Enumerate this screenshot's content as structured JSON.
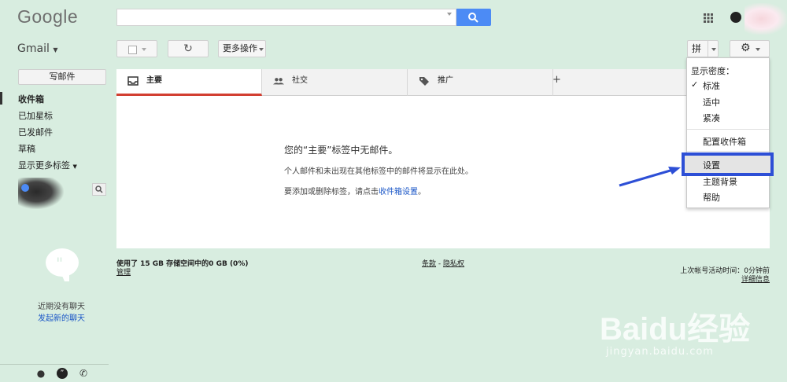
{
  "header": {
    "logo": "Google",
    "search": {
      "value": "",
      "placeholder": ""
    }
  },
  "toolbar": {
    "app_switcher_label": "Gmail",
    "refresh_icon": "refresh-icon",
    "more_actions_label": "更多操作",
    "input_tool_label": "拼"
  },
  "sidebar": {
    "compose_label": "写邮件",
    "items": [
      {
        "label": "收件箱",
        "active": true
      },
      {
        "label": "已加星标"
      },
      {
        "label": "已发邮件"
      },
      {
        "label": "草稿"
      },
      {
        "label": "显示更多标签"
      }
    ]
  },
  "chat": {
    "empty_text": "近期没有聊天",
    "start_link": "发起新的聊天"
  },
  "tabs": [
    {
      "label": "主要",
      "icon": "inbox-icon",
      "active": true
    },
    {
      "label": "社交",
      "icon": "people-icon"
    },
    {
      "label": "推广",
      "icon": "tag-icon"
    }
  ],
  "empty_state": {
    "title": "您的“主要”标签中无邮件。",
    "line1": "个人邮件和未出现在其他标签中的邮件将显示在此处。",
    "line2_prefix": "要添加或删除标签，请点击",
    "line2_link": "收件箱设置",
    "line2_suffix": "。"
  },
  "footer": {
    "storage": "使用了 15 GB 存储空间中的0 GB (0%)",
    "manage": "管理",
    "terms": "条款",
    "separator": " - ",
    "privacy": "隐私权",
    "last_activity": "上次帐号活动时间：0分钟前",
    "details": "详细信息"
  },
  "settings_menu": {
    "density_header": "显示密度：",
    "density_options": [
      "标准",
      "适中",
      "紧凑"
    ],
    "selected_density": "标准",
    "configure_inbox": "配置收件箱",
    "settings": "设置",
    "themes": "主题背景",
    "help": "帮助"
  },
  "watermark": {
    "brand": "Baidu经验",
    "url": "jingyan.baidu.com"
  },
  "colors": {
    "background": "#d8ede0",
    "search_button": "#4c8bf5",
    "active_tab": "#d23f31",
    "link": "#1a56c7",
    "annotation": "#2d4fd6"
  }
}
